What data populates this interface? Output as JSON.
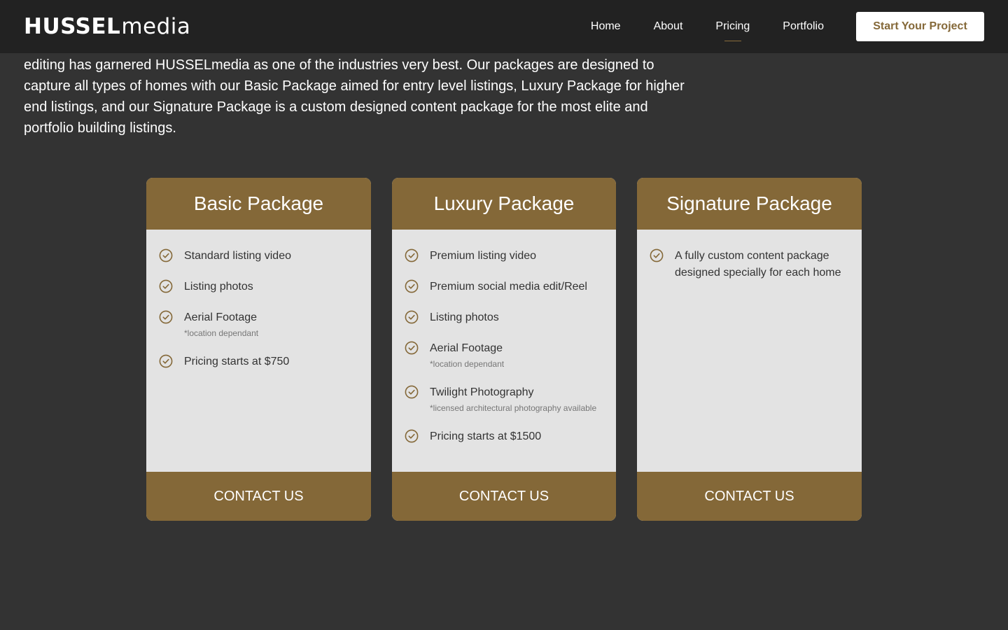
{
  "nav": {
    "logo_bold": "HUSSEL",
    "logo_light": "media",
    "links": [
      "Home",
      "About",
      "Pricing",
      "Portfolio"
    ],
    "active_link": "Pricing",
    "cta": "Start Your Project"
  },
  "intro": "editing has garnered HUSSELmedia as one of the industries very best. Our packages are designed to capture all types of homes with our Basic Package aimed for entry level listings, Luxury Package for higher end listings, and our Signature Package is a custom designed content package for the most elite and portfolio building listings.",
  "colors": {
    "accent": "#846838",
    "background": "#333333",
    "nav_bg": "#222222",
    "card_bg": "#e3e3e3"
  },
  "packages": [
    {
      "title": "Basic Package",
      "features": [
        {
          "text": "Standard listing video",
          "note": ""
        },
        {
          "text": "Listing photos",
          "note": ""
        },
        {
          "text": "Aerial Footage",
          "note": "*location dependant"
        },
        {
          "text": "Pricing starts at $750",
          "note": ""
        }
      ],
      "button": "CONTACT US"
    },
    {
      "title": "Luxury Package",
      "features": [
        {
          "text": "Premium listing video",
          "note": ""
        },
        {
          "text": "Premium social media edit/Reel",
          "note": ""
        },
        {
          "text": "Listing photos",
          "note": ""
        },
        {
          "text": "Aerial Footage",
          "note": "*location dependant"
        },
        {
          "text": "Twilight Photography",
          "note": "*licensed architectural photography available"
        },
        {
          "text": "Pricing starts at $1500",
          "note": ""
        }
      ],
      "button": "CONTACT US"
    },
    {
      "title": "Signature Package",
      "features": [
        {
          "text": "A fully custom content package designed specially for each home",
          "note": ""
        }
      ],
      "button": "CONTACT US"
    }
  ],
  "icons": {
    "feature": "check-circle-icon"
  }
}
